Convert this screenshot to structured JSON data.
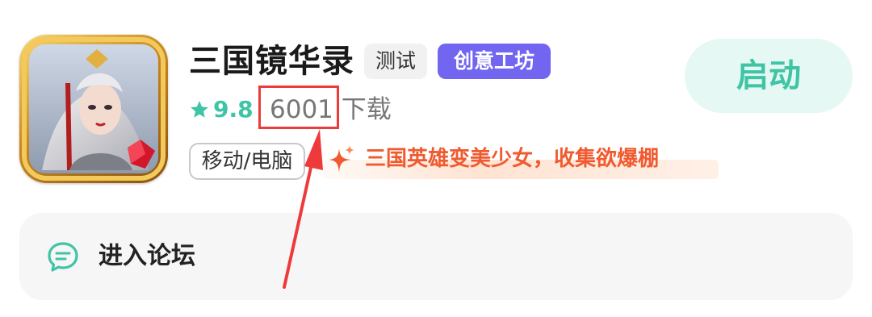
{
  "app": {
    "title": "三国镜华录",
    "tags": {
      "test": "测试",
      "workshop": "创意工坊"
    },
    "rating": "9.8",
    "download_count": "6001",
    "download_suffix": "下载",
    "platform": "移动/电脑",
    "slogan": "三国英雄变美少女，收集欲爆棚",
    "launch_label": "启动"
  },
  "forum": {
    "label": "进入论坛"
  },
  "icons": {
    "rating": "star-icon",
    "slogan": "sparkle-icon",
    "forum": "chat-bubble-icon",
    "app": "app-icon"
  },
  "colors": {
    "accent_green": "#3fc4a5",
    "workshop_purple": "#7265f0",
    "slogan_orange": "#f05a2f",
    "annotation_red": "#ee3a3a"
  }
}
